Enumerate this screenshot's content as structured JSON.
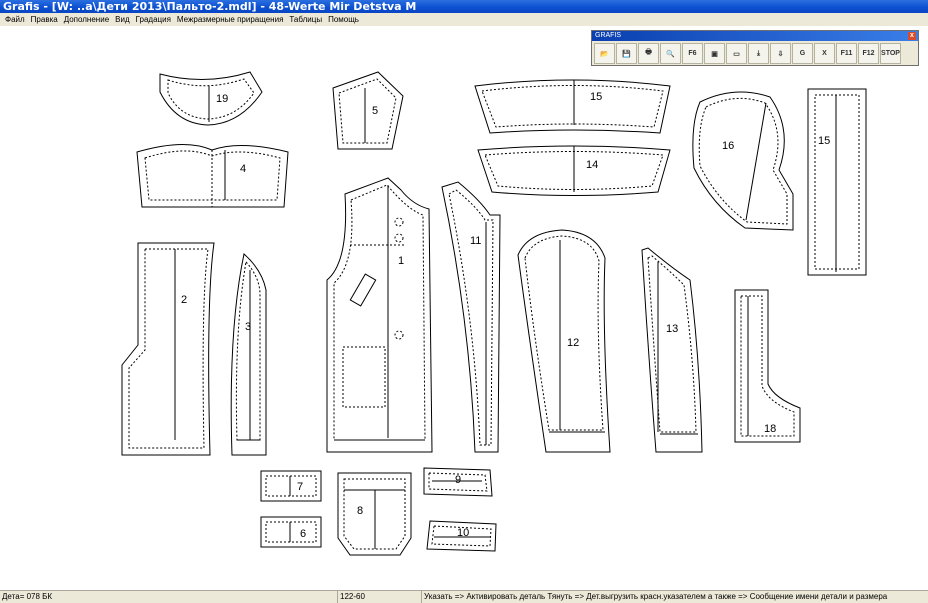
{
  "window": {
    "title": "Grafis - [W: ..a\\Дети 2013\\Пальто-2.mdl] - 48-Werte Mir Detstva M"
  },
  "menu": {
    "items": [
      "Файл",
      "Правка",
      "Дополнение",
      "Вид",
      "Градация",
      "Межразмерные приращения",
      "Таблицы",
      "Помощь"
    ]
  },
  "toolbar": {
    "title": "GRAFIS",
    "close_label": "x",
    "buttons": [
      {
        "icon": "open-folder-icon",
        "glyph": "📂"
      },
      {
        "icon": "save-icon",
        "glyph": "💾"
      },
      {
        "icon": "print-icon",
        "glyph": "🖶"
      },
      {
        "icon": "zoom-icon",
        "glyph": "🔍"
      },
      {
        "icon": "f6-icon",
        "glyph": "F6"
      },
      {
        "icon": "copy-icon",
        "glyph": "▣"
      },
      {
        "icon": "ruler-icon",
        "glyph": "▭"
      },
      {
        "icon": "download-icon",
        "glyph": "⤓"
      },
      {
        "icon": "import-icon",
        "glyph": "⇩"
      },
      {
        "icon": "g-icon",
        "glyph": "G"
      },
      {
        "icon": "x-icon",
        "glyph": "X"
      },
      {
        "icon": "f11-icon",
        "glyph": "F11"
      },
      {
        "icon": "f12-icon",
        "glyph": "F12"
      },
      {
        "icon": "stop-icon",
        "glyph": "STOP"
      }
    ]
  },
  "pieces": {
    "p1": "1",
    "p2": "2",
    "p3": "3",
    "p4": "4",
    "p5": "5",
    "p6": "6",
    "p7": "7",
    "p8": "8",
    "p9": "9",
    "p10": "10",
    "p11": "11",
    "p12": "12",
    "p13": "13",
    "p14": "14",
    "p15a": "15",
    "p15b": "15",
    "p16": "16",
    "p18": "18",
    "p19": "19"
  },
  "status": {
    "left": "Детa= 078  БК",
    "coords": "122-60",
    "hint": "Указать => Активировать деталь Тянуть => Дет.выгрузить красн.указателем а также => Сообщение имени детали и размера"
  }
}
